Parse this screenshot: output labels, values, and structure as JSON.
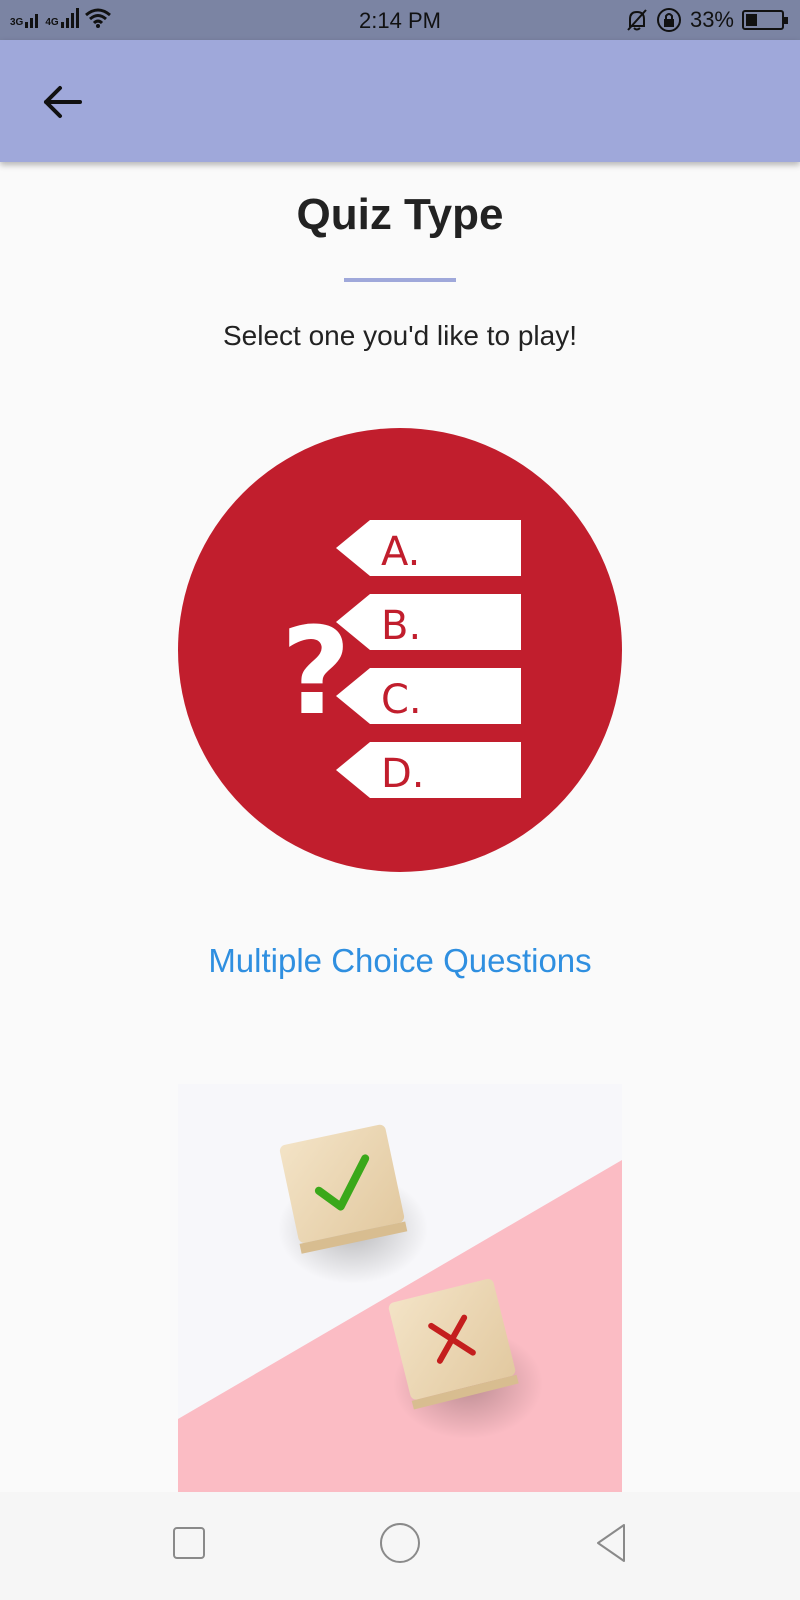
{
  "status_bar": {
    "network_1": "3G",
    "network_2": "4G",
    "time": "2:14 PM",
    "battery_percent": "33%",
    "battery_level": 0.33,
    "icons": [
      "signal-icon",
      "wifi-icon",
      "bell-off-icon",
      "rotation-lock-icon",
      "battery-icon"
    ]
  },
  "app_bar": {
    "back_icon": "arrow-left-icon",
    "color": "#9fa8da"
  },
  "page": {
    "title": "Quiz Type",
    "subtitle": "Select one you'd like to play!"
  },
  "quiz_types": [
    {
      "label": "Multiple Choice Questions",
      "options": [
        "A.",
        "B.",
        "C.",
        "D."
      ],
      "symbol": "?",
      "color": "#c11e2d"
    },
    {
      "image": "true-false-blocks",
      "icons": [
        "check-icon",
        "cross-icon"
      ]
    }
  ],
  "nav_bar": {
    "icons": [
      "recents-square-icon",
      "home-circle-icon",
      "back-triangle-icon"
    ]
  },
  "colors": {
    "accent": "#9fa8da",
    "link": "#2f8fe0",
    "mcq_red": "#c11e2d",
    "pink": "#fbbcc4"
  }
}
